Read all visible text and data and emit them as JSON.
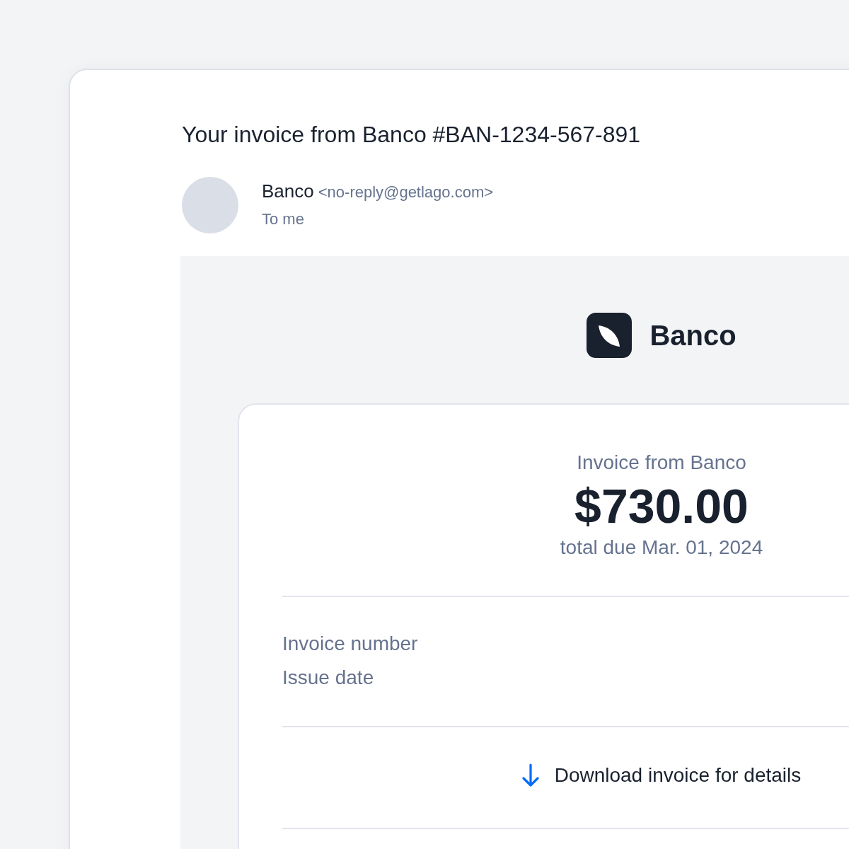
{
  "email": {
    "subject": "Your invoice from Banco #BAN-1234-567-891",
    "sender": {
      "name": "Banco",
      "address": "<no-reply@getlago.com>",
      "recipient": "To me"
    }
  },
  "body": {
    "brand": {
      "name": "Banco"
    },
    "invoice": {
      "title": "Invoice from Banco",
      "amount": "$730.00",
      "due": "total due Mar. 01, 2024",
      "details": [
        {
          "label": "Invoice number"
        },
        {
          "label": "Issue date"
        }
      ],
      "download_link": "Download invoice for details"
    }
  }
}
